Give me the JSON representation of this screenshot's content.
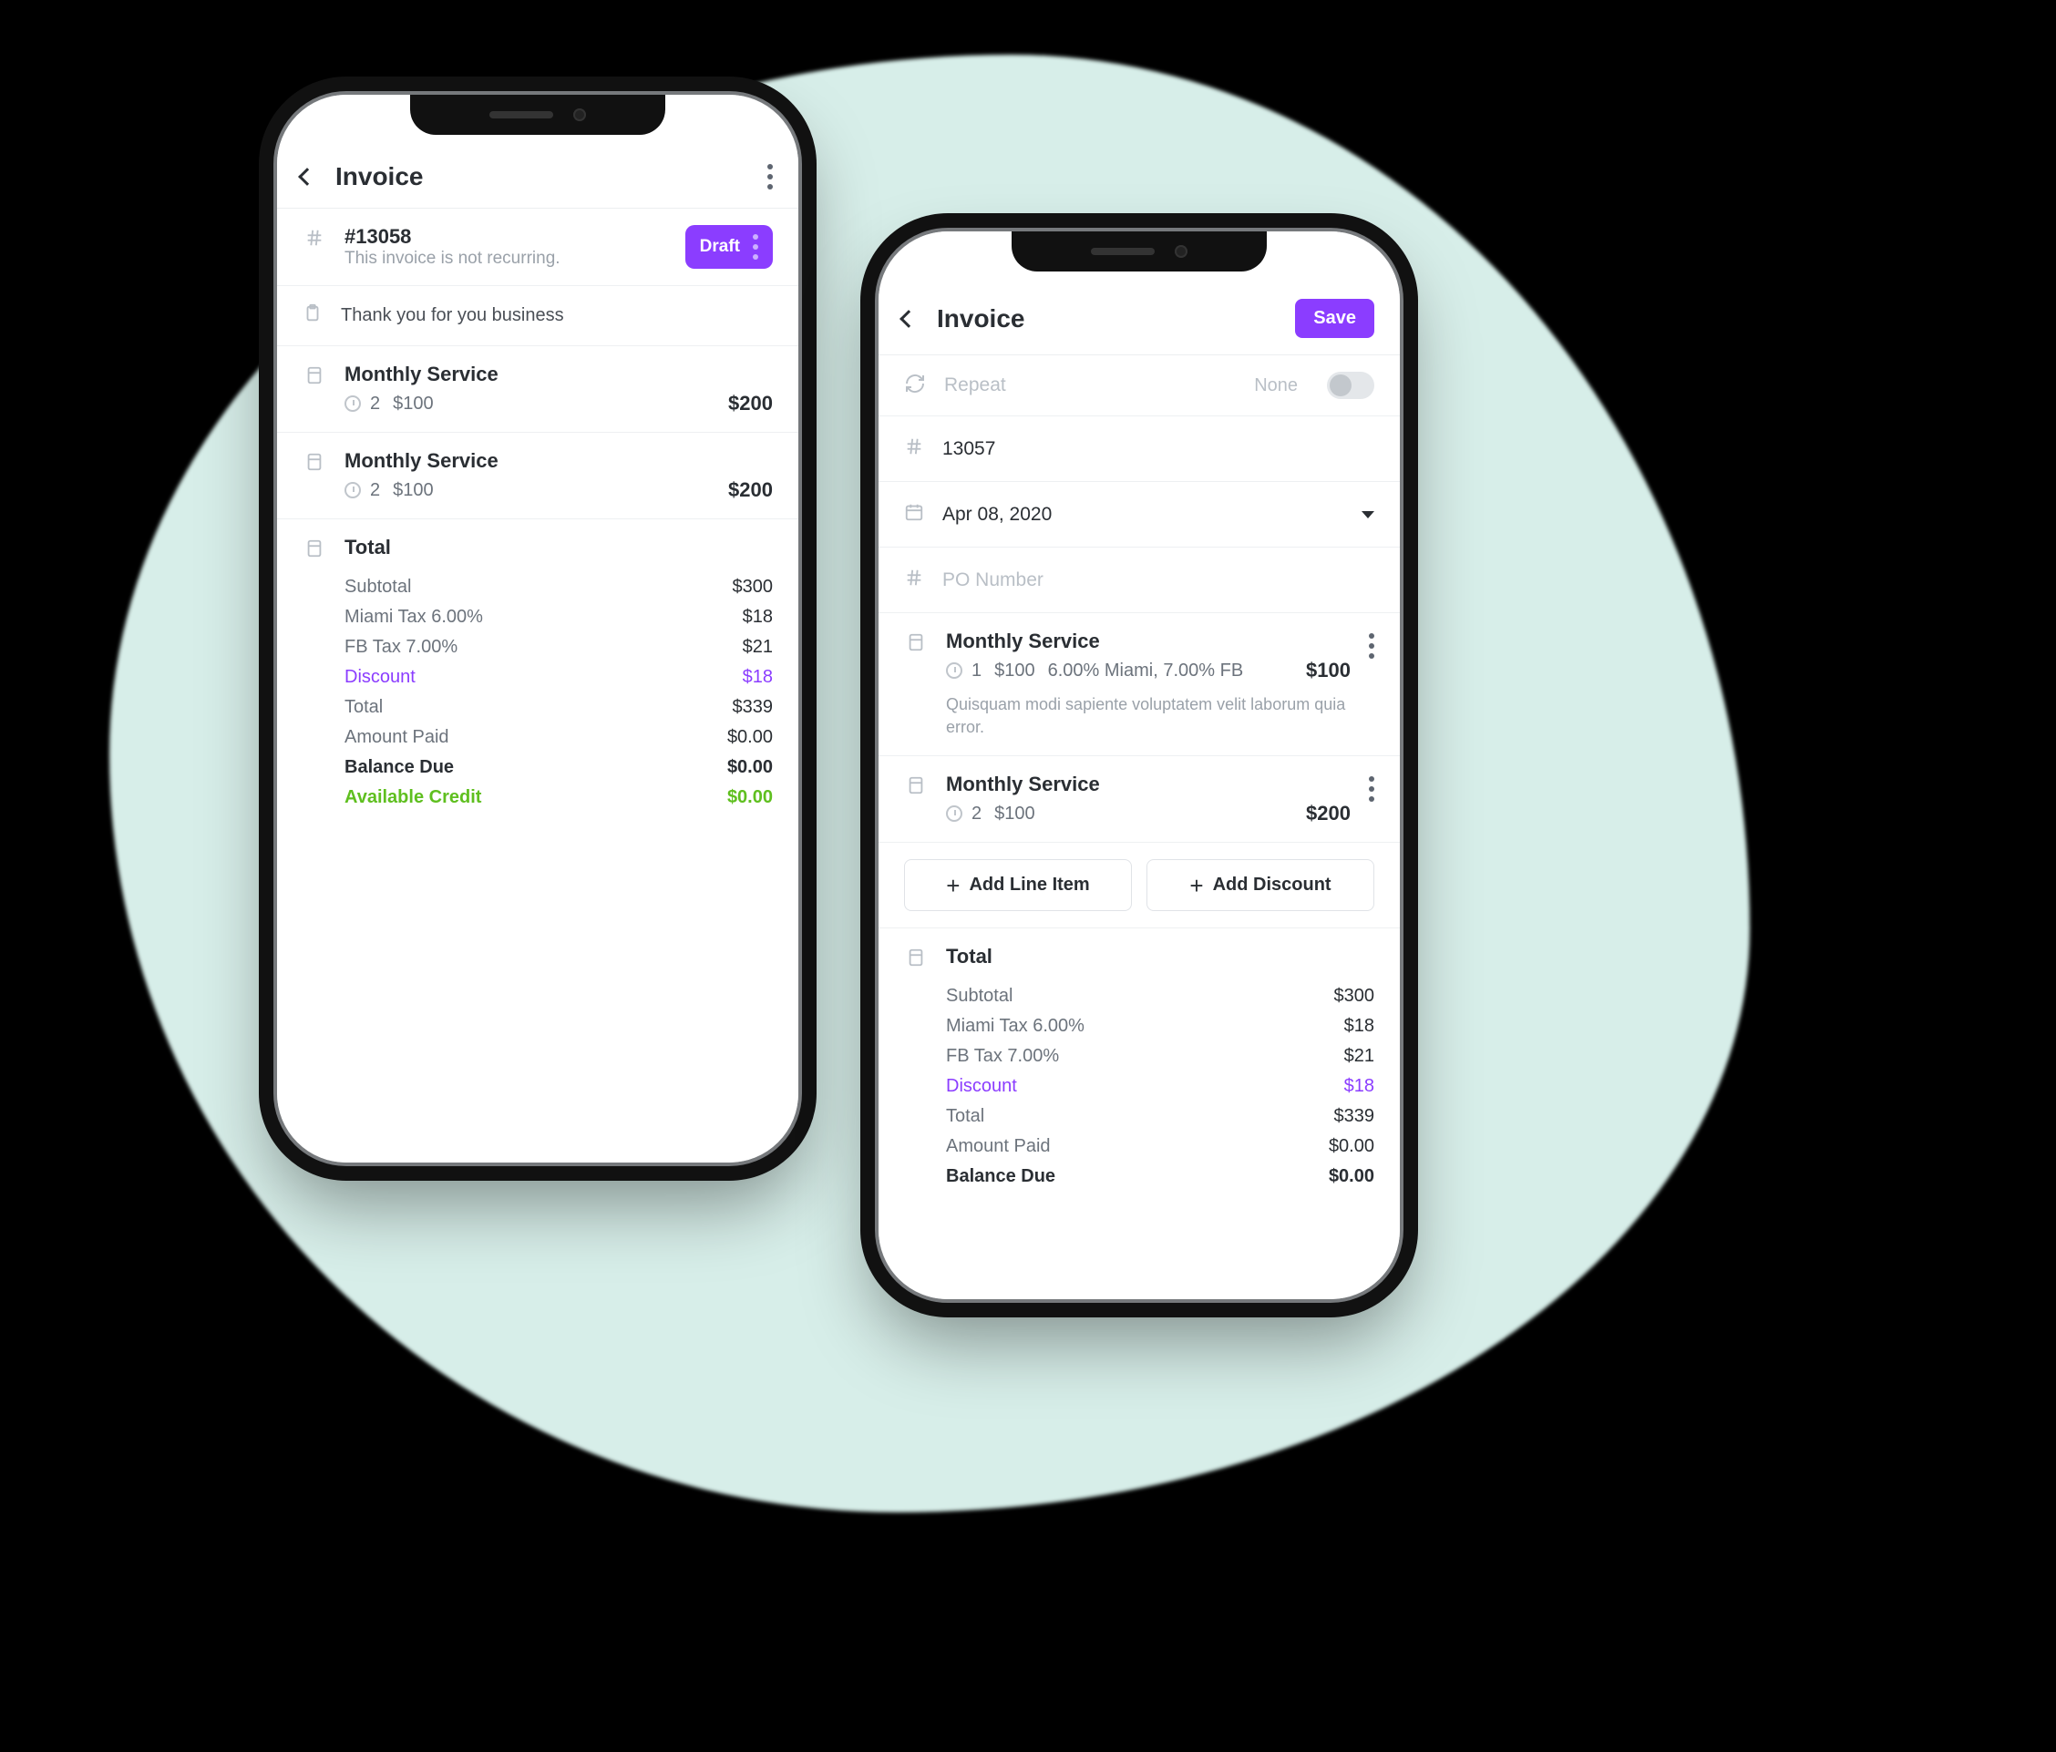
{
  "colors": {
    "accent": "#8b3dff",
    "green": "#5fbf1f"
  },
  "left_phone": {
    "header": {
      "title": "Invoice"
    },
    "status": {
      "number": "#13058",
      "recurring_note": "This invoice is not recurring.",
      "badge": "Draft"
    },
    "note": "Thank you for you business",
    "items": [
      {
        "name": "Monthly Service",
        "qty": "2",
        "unit": "$100",
        "amount": "$200"
      },
      {
        "name": "Monthly Service",
        "qty": "2",
        "unit": "$100",
        "amount": "$200"
      }
    ],
    "totals": {
      "title": "Total",
      "lines": [
        {
          "label": "Subtotal",
          "value": "$300",
          "style": "normal"
        },
        {
          "label": "Miami Tax 6.00%",
          "value": "$18",
          "style": "normal"
        },
        {
          "label": "FB Tax 7.00%",
          "value": "$21",
          "style": "normal"
        },
        {
          "label": "Discount",
          "value": "$18",
          "style": "purple"
        },
        {
          "label": "Total",
          "value": "$339",
          "style": "normal"
        },
        {
          "label": "Amount Paid",
          "value": "$0.00",
          "style": "normal"
        },
        {
          "label": "Balance Due",
          "value": "$0.00",
          "style": "bold"
        },
        {
          "label": "Available Credit",
          "value": "$0.00",
          "style": "green"
        }
      ]
    }
  },
  "right_phone": {
    "header": {
      "title": "Invoice",
      "save": "Save"
    },
    "repeat": {
      "label": "Repeat",
      "value": "None"
    },
    "number": "13057",
    "date": "Apr 08, 2020",
    "po_placeholder": "PO Number",
    "items": [
      {
        "name": "Monthly Service",
        "qty": "1",
        "unit": "$100",
        "tax": "6.00% Miami, 7.00% FB",
        "amount": "$100",
        "desc": "Quisquam modi sapiente voluptatem velit laborum quia error."
      },
      {
        "name": "Monthly Service",
        "qty": "2",
        "unit": "$100",
        "amount": "$200"
      }
    ],
    "buttons": {
      "add_line": "Add Line Item",
      "add_discount": "Add Discount"
    },
    "totals": {
      "title": "Total",
      "lines": [
        {
          "label": "Subtotal",
          "value": "$300",
          "style": "normal"
        },
        {
          "label": "Miami Tax 6.00%",
          "value": "$18",
          "style": "normal"
        },
        {
          "label": "FB Tax 7.00%",
          "value": "$21",
          "style": "normal"
        },
        {
          "label": "Discount",
          "value": "$18",
          "style": "purple"
        },
        {
          "label": "Total",
          "value": "$339",
          "style": "normal"
        },
        {
          "label": "Amount Paid",
          "value": "$0.00",
          "style": "normal"
        },
        {
          "label": "Balance Due",
          "value": "$0.00",
          "style": "bold"
        }
      ]
    }
  }
}
